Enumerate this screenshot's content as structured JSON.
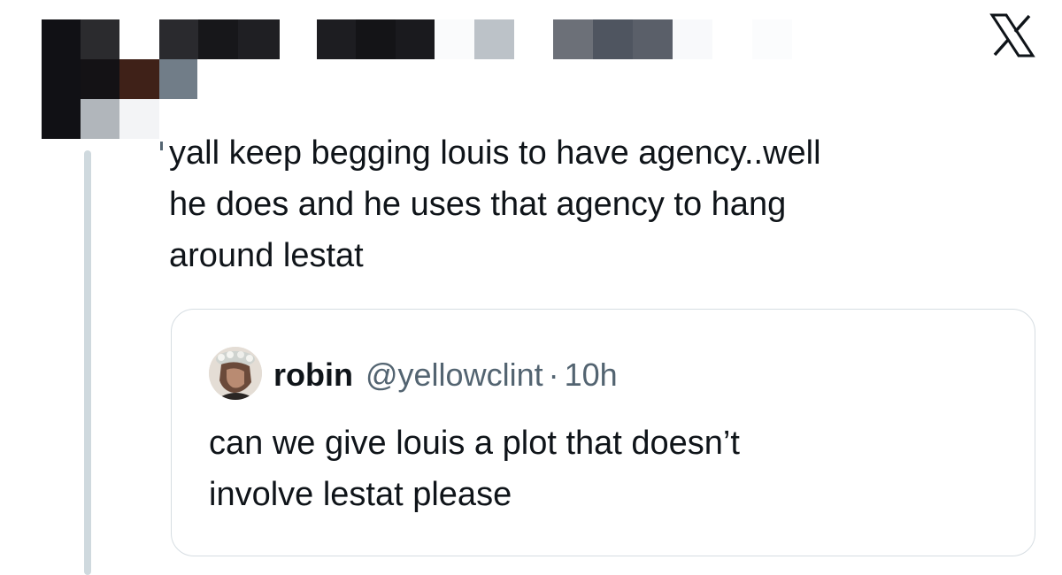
{
  "header": {
    "logo_icon": "x-logo-icon",
    "redaction_colors": [
      "#111115",
      "#2b2b2e",
      "#1c1c1f",
      "#bcc2c8",
      "#6c7078",
      "#4f5560",
      "#3f2118",
      "#717d88",
      "#b1b6bb"
    ]
  },
  "tweet": {
    "text": "yall keep begging louis to have agency..well\nhe does and he uses that agency to hang\naround lestat"
  },
  "quote": {
    "name": "robin",
    "handle": "@yellowclint",
    "separator": "·",
    "time": "10h",
    "text": "can we give louis a plot that doesn’t\ninvolve lestat please",
    "avatar_icon": "user-avatar"
  },
  "colors": {
    "text": "#0f1419",
    "secondary": "#536471",
    "border": "#d6dde2",
    "thread_line": "#cfd9de"
  }
}
